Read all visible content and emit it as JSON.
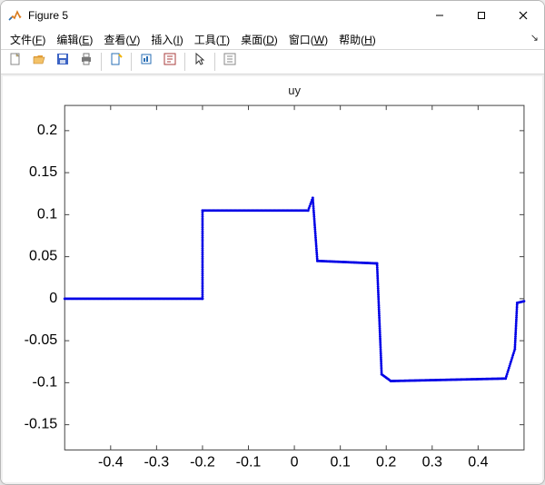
{
  "window": {
    "title": "Figure 5"
  },
  "menu": {
    "items": [
      {
        "label": "文件",
        "mn": "F"
      },
      {
        "label": "编辑",
        "mn": "E"
      },
      {
        "label": "查看",
        "mn": "V"
      },
      {
        "label": "插入",
        "mn": "I"
      },
      {
        "label": "工具",
        "mn": "T"
      },
      {
        "label": "桌面",
        "mn": "D"
      },
      {
        "label": "窗口",
        "mn": "W"
      },
      {
        "label": "帮助",
        "mn": "H"
      }
    ]
  },
  "toolbar": {
    "icons": [
      "new",
      "open",
      "save",
      "print",
      "sep",
      "link",
      "sep",
      "rotate",
      "datacursor",
      "sep",
      "pointer",
      "sep",
      "edit"
    ]
  },
  "chart_data": {
    "type": "scatter",
    "title": "uy",
    "xlabel": "",
    "ylabel": "",
    "xlim": [
      -0.5,
      0.5
    ],
    "ylim": [
      -0.18,
      0.23
    ],
    "xticks": [
      -0.4,
      -0.3,
      -0.2,
      -0.1,
      0,
      0.1,
      0.2,
      0.3,
      0.4
    ],
    "yticks": [
      -0.15,
      -0.1,
      -0.05,
      0,
      0.05,
      0.1,
      0.15,
      0.2
    ],
    "segments": [
      {
        "x0": -0.5,
        "x1": -0.2,
        "y0": 0.0,
        "y1": 0.0
      },
      {
        "x0": -0.2,
        "x1": -0.2,
        "y0": 0.0,
        "y1": 0.105
      },
      {
        "x0": -0.2,
        "x1": 0.03,
        "y0": 0.105,
        "y1": 0.105
      },
      {
        "x0": 0.03,
        "x1": 0.04,
        "y0": 0.105,
        "y1": 0.12
      },
      {
        "x0": 0.04,
        "x1": 0.05,
        "y0": 0.12,
        "y1": 0.045
      },
      {
        "x0": 0.05,
        "x1": 0.18,
        "y0": 0.045,
        "y1": 0.042
      },
      {
        "x0": 0.18,
        "x1": 0.19,
        "y0": 0.042,
        "y1": -0.09
      },
      {
        "x0": 0.19,
        "x1": 0.21,
        "y0": -0.09,
        "y1": -0.098
      },
      {
        "x0": 0.21,
        "x1": 0.46,
        "y0": -0.098,
        "y1": -0.095
      },
      {
        "x0": 0.46,
        "x1": 0.48,
        "y0": -0.095,
        "y1": -0.06
      },
      {
        "x0": 0.48,
        "x1": 0.485,
        "y0": -0.06,
        "y1": -0.005
      },
      {
        "x0": 0.485,
        "x1": 0.5,
        "y0": -0.005,
        "y1": -0.003
      }
    ]
  }
}
